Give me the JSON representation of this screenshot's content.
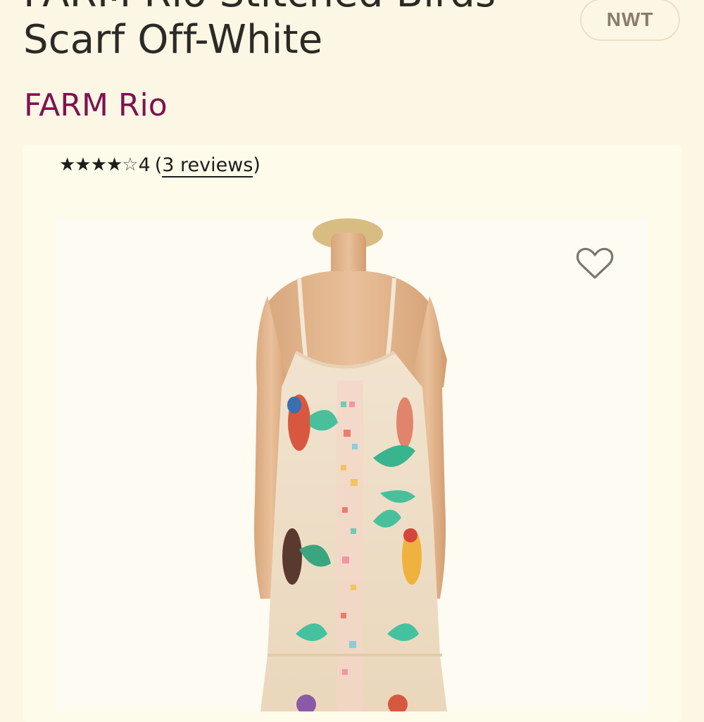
{
  "product": {
    "title_line1": "FARM Rio Stitched Birds",
    "title_line2": "Scarf Off-White",
    "condition_badge": "NWT",
    "brand": "FARM Rio"
  },
  "rating": {
    "stars": "★★★★",
    "half_star": "☆",
    "value": "4",
    "open_paren": "(",
    "reviews_label": "3 reviews",
    "close_paren": ")",
    "value_out_of_5": 4
  },
  "colors": {
    "background": "#fcf7e4",
    "brand": "#7e1251",
    "badge_border": "#eedfc4",
    "badge_text": "#8a7c6c"
  },
  "icons": {
    "favorite": "heart-outline-icon"
  }
}
